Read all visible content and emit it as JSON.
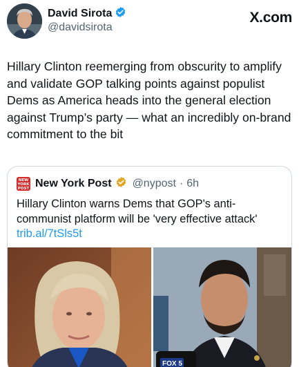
{
  "author": {
    "display_name": "David Sirota",
    "handle": "@davidsirota",
    "verified": true,
    "verified_color": "#1d9bf0",
    "avatar_icon": "avatar-photo"
  },
  "site_mark": "X.com",
  "tweet": {
    "text": "Hillary Clinton reemerging from obscurity to amplify and validate GOP talking points against populist Dems as America heads into the general election against Trump’s party — what an incredibly on-brand commitment to the bit"
  },
  "quoted": {
    "logo_text": "NEW YORK POST",
    "display_name": "New York Post",
    "verified_badge": "gold-check",
    "verified_color": "#e2a526",
    "handle": "@nypost",
    "separator": "·",
    "time": "6h",
    "text": "Hillary Clinton warns Dems that GOP's anti-communist platform will be 'very effective attack'",
    "link": "trib.al/7tSls5t",
    "link_color": "#1d9bf0",
    "images": [
      {
        "name": "hillary-clinton-photo"
      },
      {
        "name": "abdul-el-sayed-photo",
        "mic_label": "FOX 5"
      }
    ]
  }
}
